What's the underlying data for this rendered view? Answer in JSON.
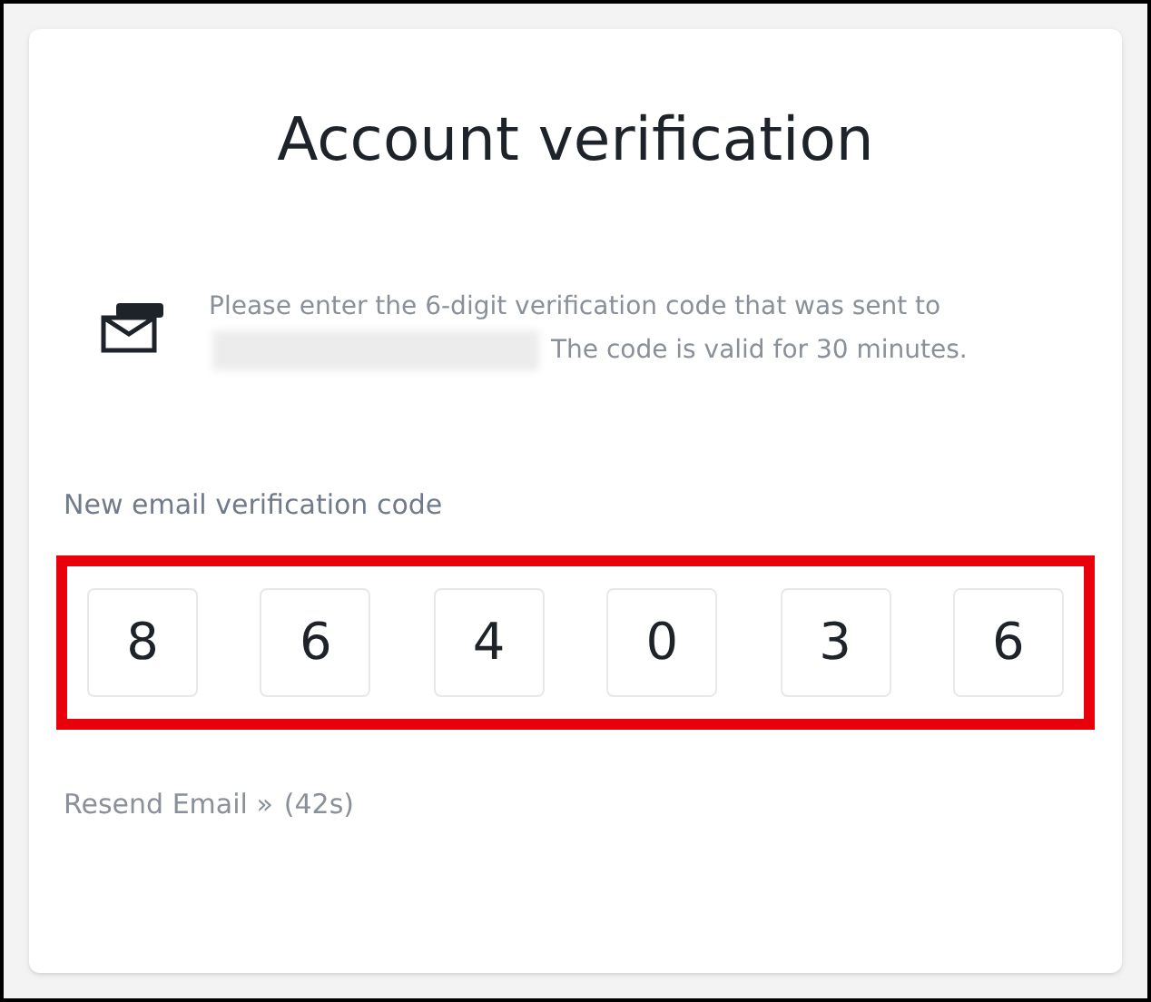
{
  "title": "Account verification",
  "message": {
    "before": "Please enter the 6-digit verification code that was sent to",
    "redacted": true,
    "after": "The code is valid for 30 minutes."
  },
  "code_field": {
    "label": "New email verification code",
    "digits": [
      "8",
      "6",
      "4",
      "0",
      "3",
      "6"
    ],
    "highlighted": true
  },
  "resend": {
    "link": "Resend Email",
    "arrow": "»",
    "countdown": "(42s)"
  }
}
